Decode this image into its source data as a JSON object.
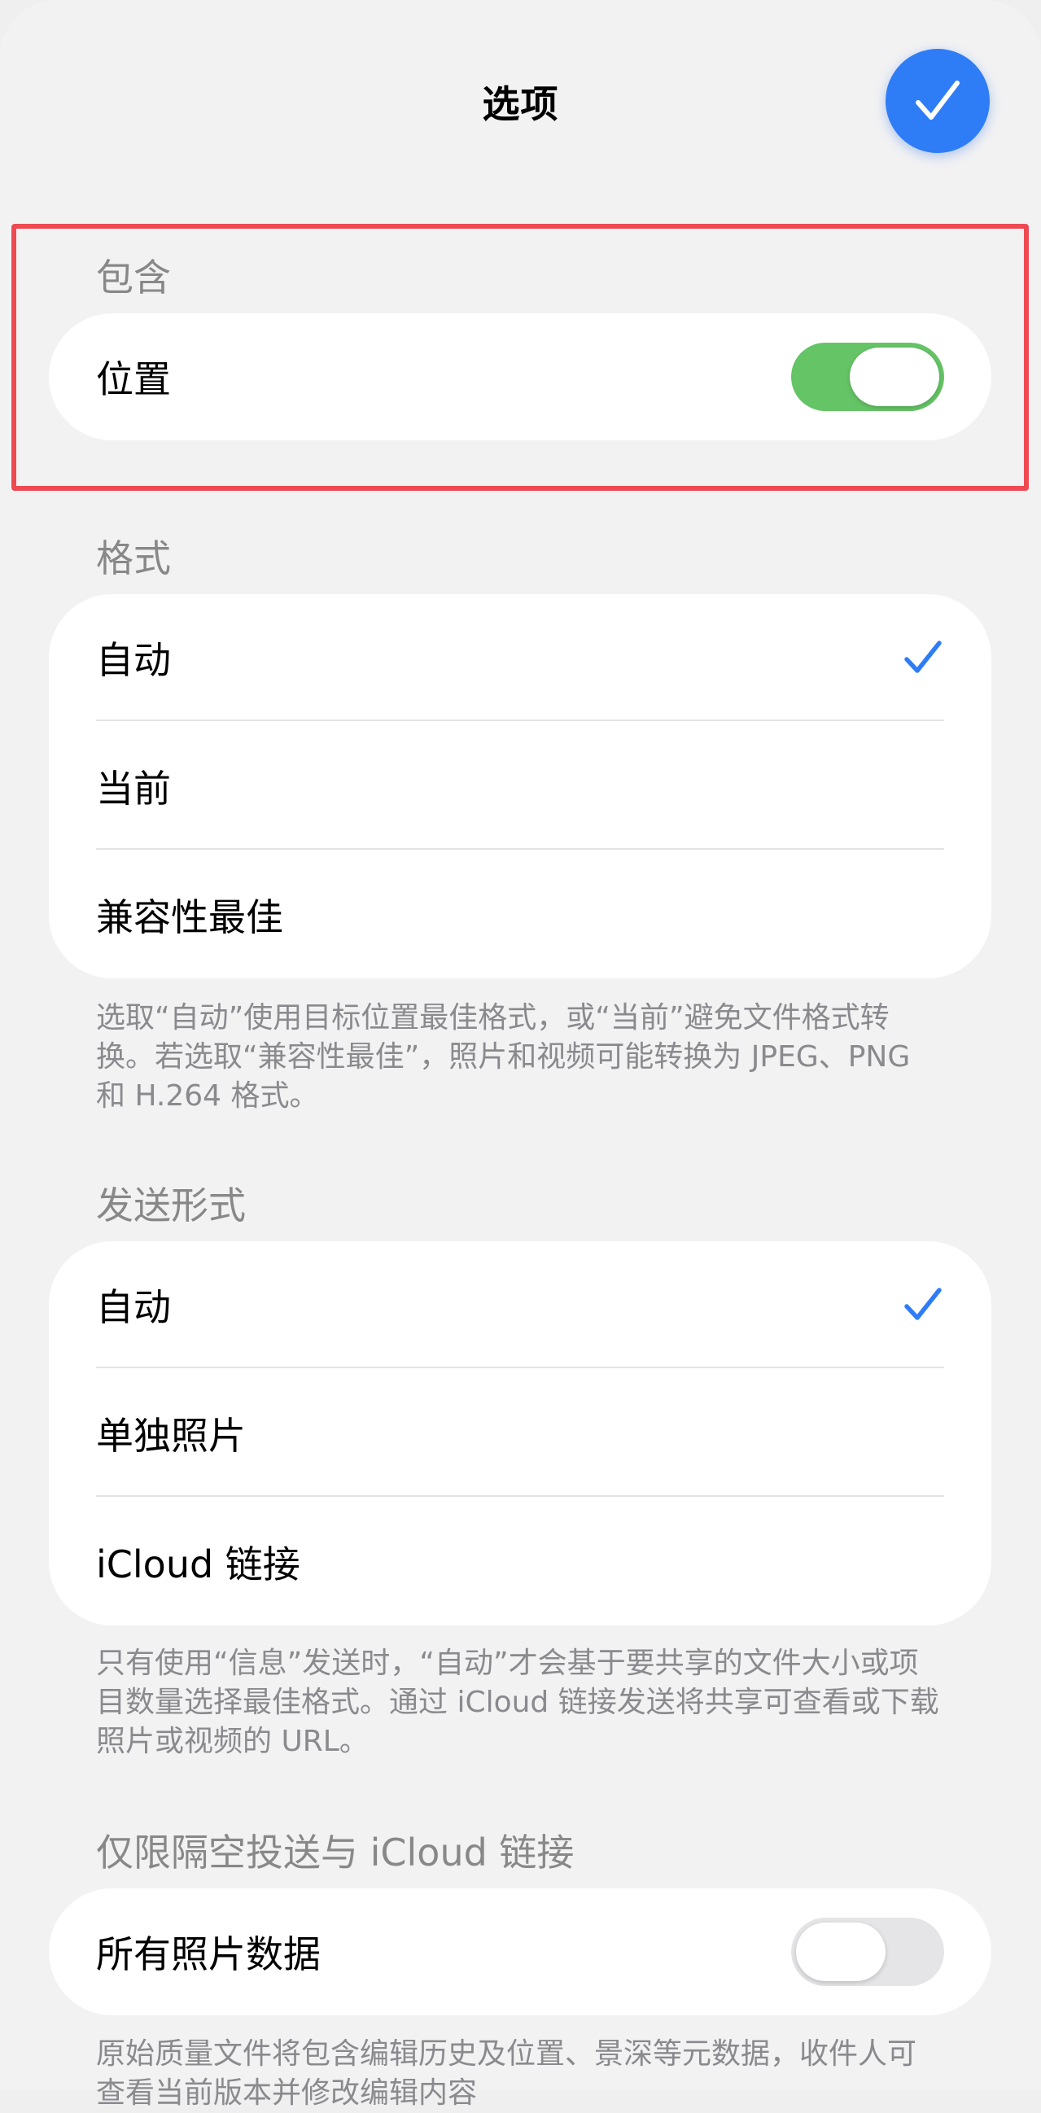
{
  "header": {
    "title": "选项",
    "done_icon": "checkmark-icon",
    "accent": "#2f7df6"
  },
  "include": {
    "label": "包含",
    "rows": [
      {
        "label": "位置",
        "toggle_on": true
      }
    ]
  },
  "format": {
    "label": "格式",
    "options": [
      {
        "label": "自动",
        "selected": true
      },
      {
        "label": "当前",
        "selected": false
      },
      {
        "label": "兼容性最佳",
        "selected": false
      }
    ],
    "footnote": "选取“自动”使用目标位置最佳格式，或“当前”避免文件格式转换。若选取“兼容性最佳”，照片和视频可能转换为 JPEG、PNG 和 H.264 格式。"
  },
  "send_as": {
    "label": "发送形式",
    "options": [
      {
        "label": "自动",
        "selected": true
      },
      {
        "label": "单独照片",
        "selected": false
      },
      {
        "label": "iCloud 链接",
        "selected": false
      }
    ],
    "footnote": "只有使用“信息”发送时，“自动”才会基于要共享的文件大小或项目数量选择最佳格式。通过 iCloud 链接发送将共享可查看或下载照片或视频的 URL。"
  },
  "airdrop": {
    "label": "仅限隔空投送与 iCloud 链接",
    "rows": [
      {
        "label": "所有照片数据",
        "toggle_on": false
      }
    ],
    "footnote": "原始质量文件将包含编辑历史及位置、景深等元数据，收件人可查看当前版本并修改编辑内容"
  },
  "colors": {
    "toggle_on": "#65c466",
    "checkmark": "#2f7df6",
    "highlight": "#ee4a52"
  }
}
